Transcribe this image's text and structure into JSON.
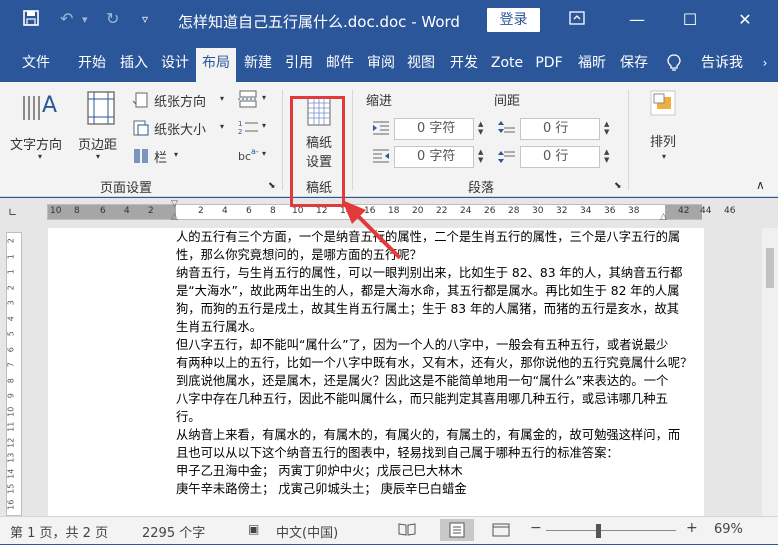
{
  "titlebar": {
    "title": "怎样知道自己五行属什么.doc.doc - Word",
    "login": "登录"
  },
  "tabs": [
    "文件",
    "开始",
    "插入",
    "设计",
    "布局",
    "新建",
    "引用",
    "邮件",
    "审阅",
    "视图",
    "开发",
    "Zote",
    "PDF",
    "福昕",
    "保存",
    "告诉我"
  ],
  "ribbon": {
    "text_direction": "文字方向",
    "margins": "页边距",
    "orientation": "纸张方向",
    "size": "纸张大小",
    "columns": "栏",
    "page_setup_group": "页面设置",
    "draft_settings_line1": "稿纸",
    "draft_settings_line2": "设置",
    "draft_group": "稿纸",
    "indent_label": "缩进",
    "spacing_label": "间距",
    "indent_left": "0 字符",
    "indent_right": "0 字符",
    "spacing_before": "0 行",
    "spacing_after": "0 行",
    "paragraph_group": "段落",
    "arrange": "排列"
  },
  "ruler": {
    "left_ticks": [
      "10",
      "8",
      "6",
      "4",
      "2"
    ],
    "mid_ticks": [
      "2",
      "4",
      "6",
      "8",
      "10",
      "12",
      "14",
      "16",
      "18",
      "20",
      "22",
      "24",
      "26",
      "28",
      "30",
      "32",
      "34",
      "36",
      "38"
    ],
    "right_ticks": [
      "42",
      "44",
      "46"
    ]
  },
  "vruler": [
    "2",
    "1",
    "1",
    "2",
    "3",
    "4",
    "5",
    "6",
    "7",
    "8",
    "9",
    "10",
    "11",
    "12",
    "13",
    "14",
    "15",
    "16"
  ],
  "document": {
    "lines": [
      "人的五行有三个方面，一个是纳音五行的属性，二个是生肖五行的属性，三个是八字五行的属",
      "性，那么你究竟想问的，是哪方面的五行呢？",
      "纳音五行，与生肖五行的属性，可以一眼判别出来，比如生于 82、83 年的人，其纳音五行都",
      "是“大海水”，故此两年出生的人，都是大海水命，其五行都是属水。再比如生于 82 年的人属",
      "狗，而狗的五行是戌土，故其生肖五行属土；生于 83 年的人属猪，而猪的五行是亥水，故其",
      "生肖五行属水。",
      "但八字五行，却不能叫“属什么”了，因为一个人的八字中，一般会有五种五行，或者说最少",
      "有两种以上的五行，比如一个八字中既有水，又有木，还有火，那你说他的五行究竟属什么呢？",
      "到底说他属水，还是属木，还是属火？因此这是不能简单地用一句“属什么”来表达的。一个",
      "八字中存在几种五行，因此不能叫属什么，而只能判定其喜用哪几种五行，或忌讳哪几种五",
      "行。",
      "从纳音上来看，有属水的，有属木的，有属火的，有属土的，有属金的，故可勉强这样问，而",
      "且也可以从以下这个纳音五行的图表中，轻易找到自己属于哪种五行的标准答案：",
      "甲子乙丑海中金；  丙寅丁卯炉中火；戊辰己巳大林木",
      "庚午辛未路傍土；  戊寅己卯城头土；  庚辰辛巳白蜡金"
    ]
  },
  "status": {
    "page": "第 1 页，共 2 页",
    "words": "2295 个字",
    "language": "中文(中国)",
    "zoom": "69%"
  }
}
